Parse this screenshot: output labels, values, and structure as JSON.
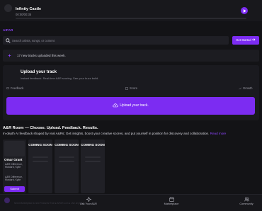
{
  "player": {
    "track_title": "Infinity Castle",
    "time": "00:00/00:35",
    "progress": 0
  },
  "brand": "AIFAR",
  "search": {
    "placeholder": "Search artists, songs, or content",
    "value": ""
  },
  "header": {
    "get_started_label": "Get Started",
    "get_started_icon": "arrow-right-icon"
  },
  "notice": {
    "text": "17 new tracks uploaded this week."
  },
  "upload": {
    "title": "Upload your track",
    "subtitle": "Instant feedback. Real-time A&R scoring. See your buzz build.",
    "steps": [
      "Feedback",
      "Score",
      "Growth"
    ],
    "button_label": "Upload your track."
  },
  "arroom": {
    "title": "A&R Room — Choose. Upload. Feedback. Results.",
    "description": "In-depth AI feedback shaped by real A&Rs; Get insights, boost your creative scores, and put yourself in position for discovery and collaboration.",
    "link": "Read more"
  },
  "profile_card": {
    "name": "Omar Grant",
    "tags": [
      "A&R Difference,",
      "Mustard, Kylie"
    ],
    "tags2": [
      "A&R Difference,",
      "Mustard, Kylie"
    ],
    "submit_label": "Submit"
  },
  "coming_soon_cards": [
    {
      "label": "COMING SOON"
    },
    {
      "label": "COMING SOON"
    },
    {
      "label": "COMING SOON"
    }
  ],
  "bottom_nav": {
    "footnote": "Need Marketplace & new Features! Trial ● AIFAR.com ● Use anything",
    "items": [
      {
        "label": "Ask Your A&R",
        "icon": "sparkle-icon"
      },
      {
        "label": "Marketplace",
        "icon": "store-icon"
      },
      {
        "label": "Community",
        "icon": "people-icon"
      }
    ]
  },
  "colors": {
    "accent": "#7c2cf2",
    "background": "#131316",
    "surface": "#1a1a1f"
  }
}
